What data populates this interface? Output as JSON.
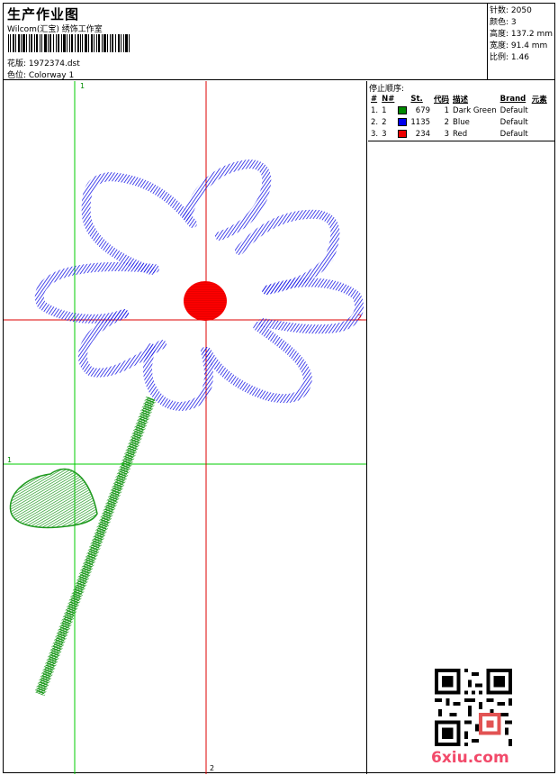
{
  "header": {
    "title": "生产作业图",
    "studio": "Wilcom(汇宝) 绣饰工作室",
    "design_label": "花版: 1972374.dst",
    "colorway_label": "色位: Colorway 1"
  },
  "stats": {
    "stitches": "针数: 2050",
    "colors": "颜色: 3",
    "height": "高度: 137.2 mm",
    "width": "宽度: 91.4 mm",
    "scale": "比例: 1.46"
  },
  "stop_sequence": {
    "title": "停止顺序:",
    "headers": [
      "#",
      "N#",
      "St.",
      "代码",
      "描述",
      "Brand",
      "元素"
    ],
    "rows": [
      {
        "index": "1.",
        "num": "1",
        "stitches": "679",
        "code": "1",
        "description": "Dark Green",
        "brand": "Default",
        "color": "#008a00"
      },
      {
        "index": "2.",
        "num": "2",
        "stitches": "1135",
        "code": "2",
        "description": "Blue",
        "brand": "Default",
        "color": "#0000ee"
      },
      {
        "index": "3.",
        "num": "3",
        "stitches": "234",
        "code": "3",
        "description": "Red",
        "brand": "Default",
        "color": "#ee0000"
      }
    ]
  },
  "axes": {
    "v1_label": "1",
    "h1_label": "1",
    "v2_label": "2",
    "h2_label": "2"
  },
  "watermark": {
    "site": "6xiu.com"
  },
  "colors": {
    "green_guide": "#00cc00",
    "red_guide": "#dd0000",
    "petal_blue": "#1a1ae6",
    "stem_green": "#1f9a1f",
    "center_red": "#ff0000"
  }
}
